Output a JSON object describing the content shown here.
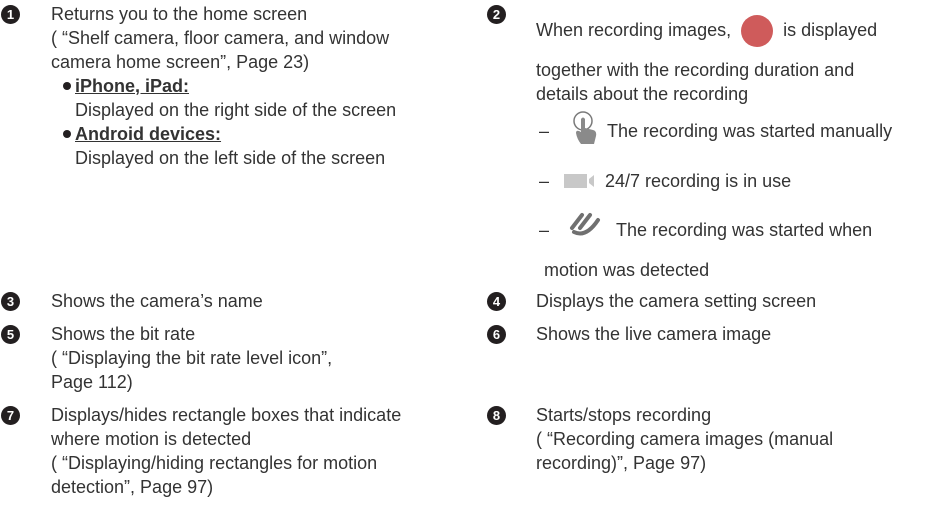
{
  "items": {
    "i1": {
      "num": "1",
      "lines": [
        "Returns you to the home screen",
        "( “Shelf camera, floor camera, and window",
        "camera home screen”, Page 23)"
      ],
      "bullets": [
        {
          "head": "iPhone, iPad:",
          "text": "Displayed on the right side of the screen"
        },
        {
          "head": "Android devices:",
          "text": "Displayed on the left side of the screen"
        }
      ]
    },
    "i2": {
      "num": "2",
      "line1_a": "When recording images,",
      "line1_b": "is displayed",
      "lines": [
        "together with the recording duration and",
        "details about the recording"
      ],
      "manual": "The recording was started manually",
      "continuous": "24/7 recording is in use",
      "motion_1": "The recording was started when",
      "motion_2": "motion was detected",
      "dash": "–"
    },
    "i3": {
      "num": "3",
      "text": "Shows the camera’s name"
    },
    "i4": {
      "num": "4",
      "text": "Displays the camera setting screen"
    },
    "i5": {
      "num": "5",
      "lines": [
        "Shows the bit rate",
        "( “Displaying the bit rate level icon”,",
        "Page 112)"
      ]
    },
    "i6": {
      "num": "6",
      "text": "Shows the live camera image"
    },
    "i7": {
      "num": "7",
      "lines": [
        "Displays/hides rectangle boxes that indicate",
        "where motion is detected",
        "( “Displaying/hiding rectangles for motion",
        "detection”, Page 97)"
      ]
    },
    "i8": {
      "num": "8",
      "lines": [
        "Starts/stops recording",
        "( “Recording camera images (manual",
        "recording)”, Page 97)"
      ]
    }
  },
  "colors": {
    "record_dot": "#cf5b5b",
    "icon_gray": "#c8c8c8",
    "badge": "#231f20"
  },
  "icons": [
    "hand-touch-icon",
    "video-camera-icon",
    "motion-waves-icon",
    "record-dot-icon"
  ]
}
